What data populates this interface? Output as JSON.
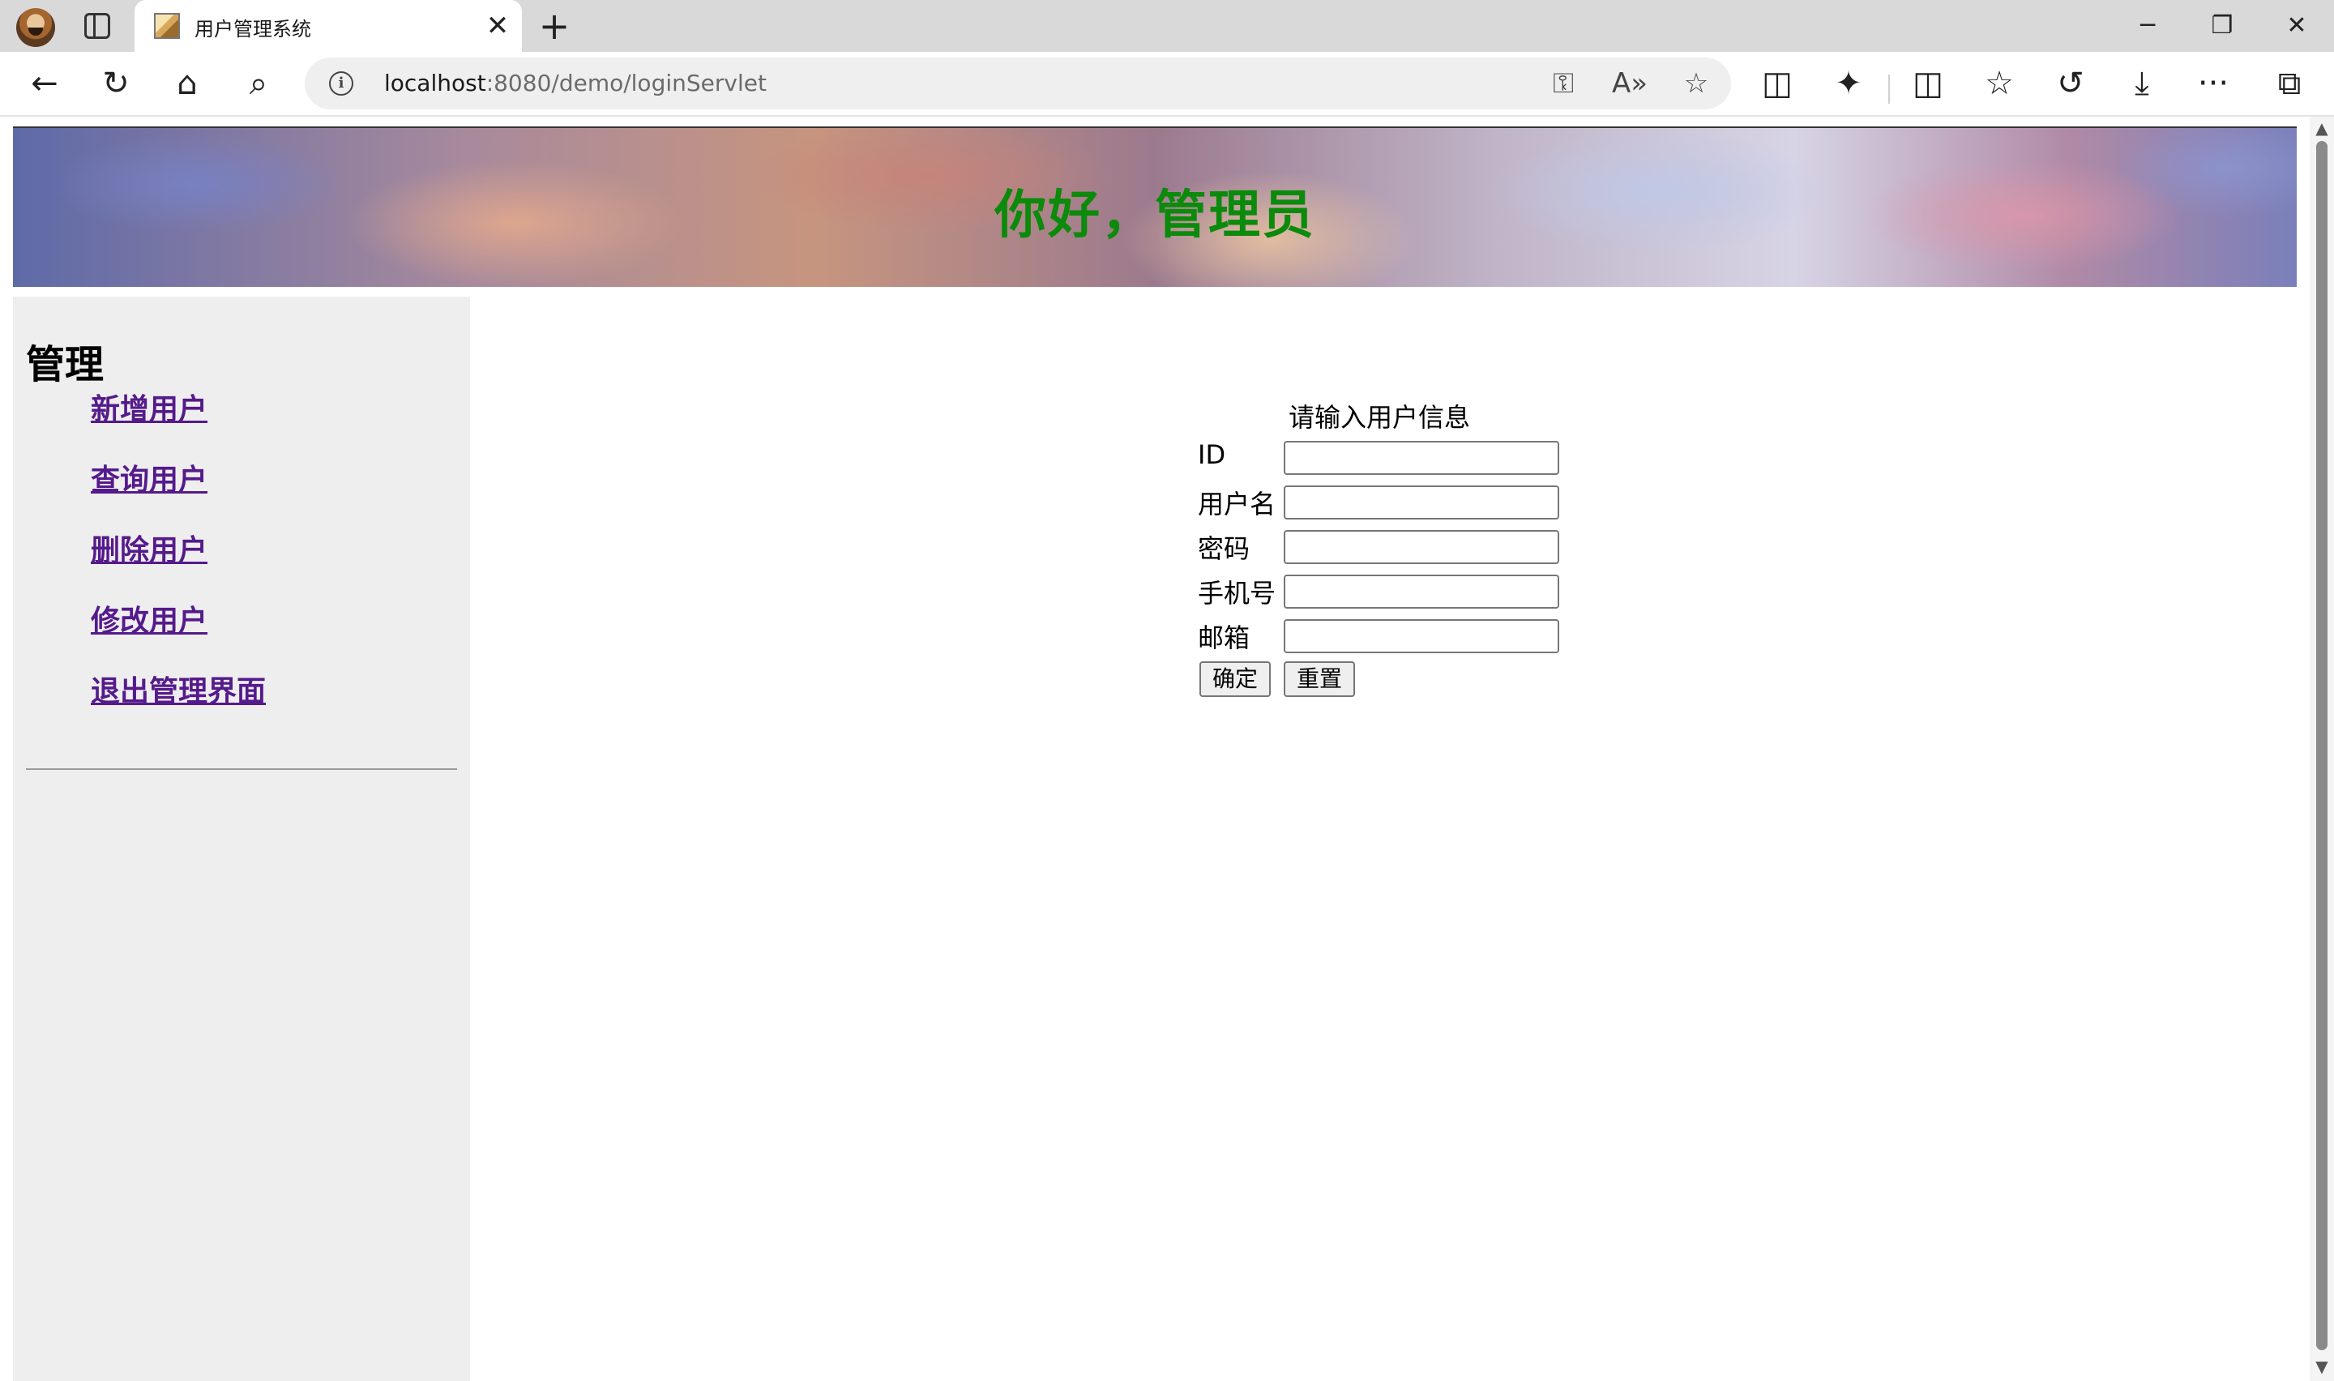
{
  "browser": {
    "tab_title": "用户管理系统",
    "tab_close": "✕",
    "new_tab": "+",
    "window": {
      "minimize": "─",
      "restore": "❐",
      "close": "✕"
    },
    "url_host": "localhost",
    "url_rest": ":8080/demo/loginServlet",
    "icons": {
      "back": "←",
      "refresh": "↻",
      "home": "⌂",
      "search": "⌕",
      "info": "i",
      "key": "⚿",
      "read_aloud": "A»",
      "favorite": "☆",
      "collections": "◫",
      "extensions": "✦",
      "split": "◫",
      "favorites": "☆",
      "history": "↺",
      "downloads": "⤓",
      "more": "···",
      "sidebar": "⧉"
    }
  },
  "page": {
    "banner_title": "你好，管理员",
    "sidebar": {
      "title": "管理",
      "links": [
        {
          "label": "新增用户"
        },
        {
          "label": "查询用户"
        },
        {
          "label": "删除用户"
        },
        {
          "label": "修改用户"
        },
        {
          "label": "退出管理界面"
        }
      ]
    },
    "form": {
      "caption": "请输入用户信息",
      "fields": [
        {
          "label": "ID",
          "value": ""
        },
        {
          "label": "用户名",
          "value": ""
        },
        {
          "label": "密码",
          "value": ""
        },
        {
          "label": "手机号",
          "value": ""
        },
        {
          "label": "邮箱",
          "value": ""
        }
      ],
      "submit_label": "确定",
      "reset_label": "重置"
    }
  }
}
